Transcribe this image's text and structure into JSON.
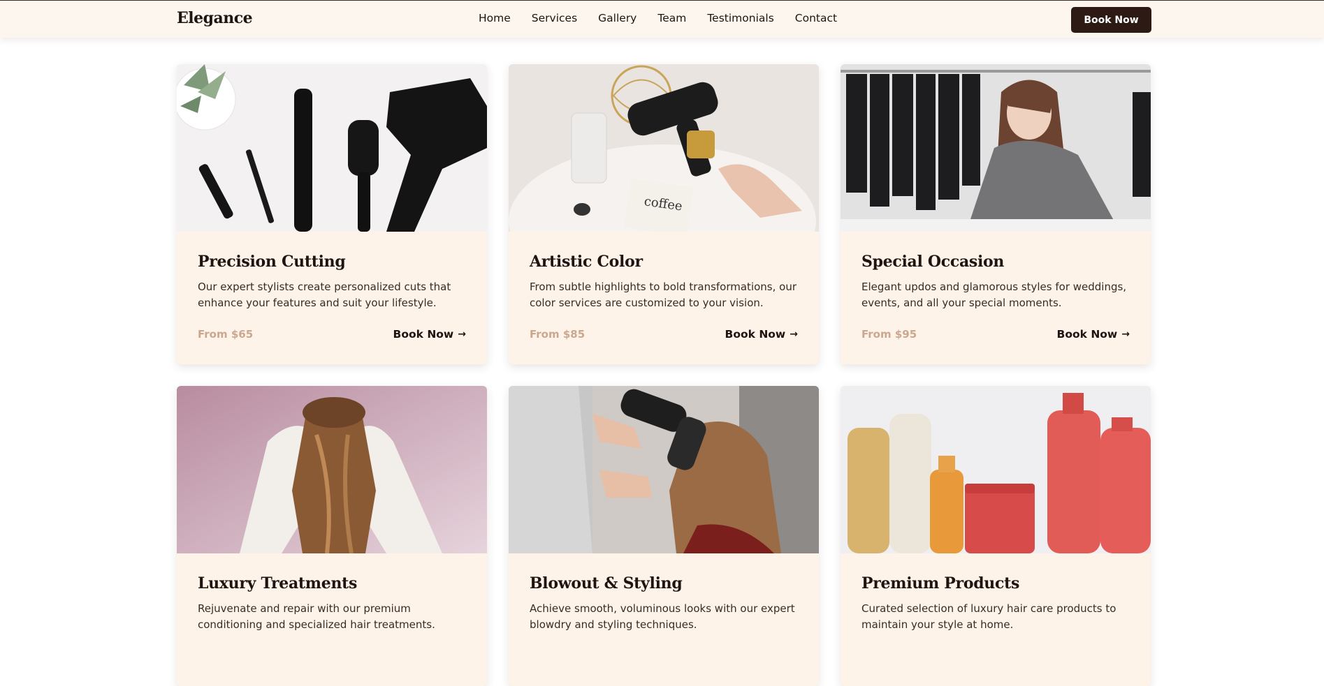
{
  "header": {
    "logo": "Elegance",
    "nav": [
      "Home",
      "Services",
      "Gallery",
      "Team",
      "Testimonials",
      "Contact"
    ],
    "book_button": "Book Now"
  },
  "colors": {
    "header_bg": "#fdf6ee",
    "card_bg": "#fdf3e9",
    "primary_dark": "#2d1a15",
    "price_color": "#c9a88f"
  },
  "services": [
    {
      "title": "Precision Cutting",
      "description": "Our expert stylists create personalized cuts that enhance your features and suit your lifestyle.",
      "price": "From $65",
      "link": "Book Now",
      "image_icon": "hair-tools-image"
    },
    {
      "title": "Artistic Color",
      "description": "From subtle highlights to bold transformations, our color services are customized to your vision.",
      "price": "From $85",
      "link": "Book Now",
      "image_icon": "hair-dryer-coffee-image",
      "image_text": "coffee"
    },
    {
      "title": "Special Occasion",
      "description": "Elegant updos and glamorous styles for weddings, events, and all your special moments.",
      "price": "From $95",
      "link": "Book Now",
      "image_icon": "stylist-smiling-image"
    },
    {
      "title": "Luxury Treatments",
      "description": "Rejuvenate and repair with our premium conditioning and specialized hair treatments.",
      "price": "",
      "link": "",
      "image_icon": "woman-long-hair-image"
    },
    {
      "title": "Blowout & Styling",
      "description": "Achieve smooth, voluminous looks with our expert blowdry and styling techniques.",
      "price": "",
      "link": "",
      "image_icon": "blowdry-session-image"
    },
    {
      "title": "Premium Products",
      "description": "Curated selection of luxury hair care products to maintain your style at home.",
      "price": "",
      "link": "",
      "image_icon": "hair-products-image"
    }
  ]
}
